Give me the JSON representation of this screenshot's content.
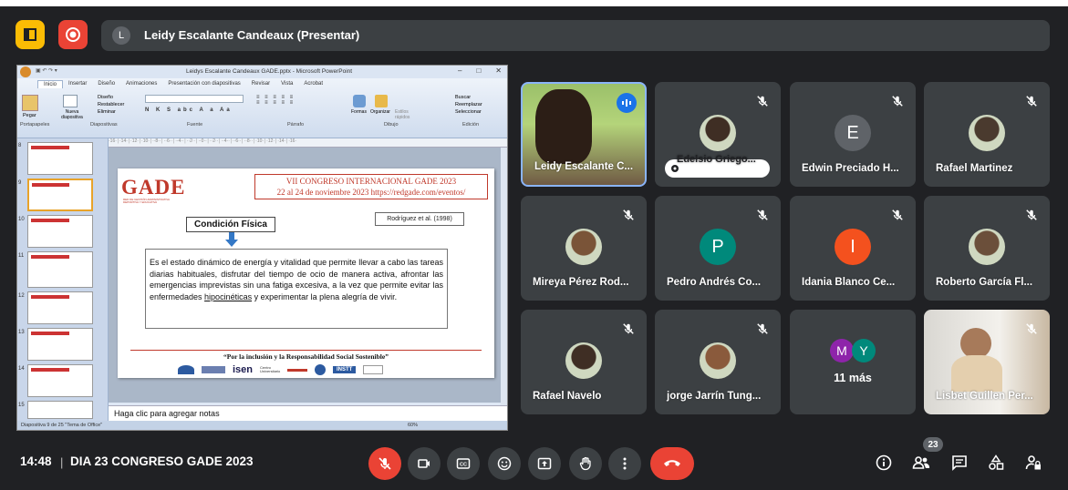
{
  "presenter_bar": {
    "initial": "L",
    "text": "Leidy Escalante Candeaux (Presentar)"
  },
  "ppt": {
    "window_title": "Leidys Escalante Candeaux GADE.pptx - Microsoft PowerPoint",
    "tabs": [
      "Inicio",
      "Insertar",
      "Diseño",
      "Animaciones",
      "Presentación con diapositivas",
      "Revisar",
      "Vista",
      "Acrobat"
    ],
    "groups": [
      "Portapapeles",
      "Diapositivas",
      "Fuente",
      "Párrafo",
      "Dibujo",
      "Edición"
    ],
    "ribbon": {
      "paste": "Pegar",
      "new_slide": "Nueva diapositiva",
      "layout": "Diseño",
      "reset": "Restablecer",
      "delete": "Eliminar",
      "shapes": "Formas",
      "arrange": "Organizar",
      "quick_styles": "Estilos rápidos",
      "find": "Buscar",
      "replace": "Reemplazar",
      "select": "Seleccionar"
    },
    "thumb_numbers": [
      "8",
      "9",
      "10",
      "11",
      "12",
      "13",
      "14",
      "15"
    ],
    "slide": {
      "logo": "GADE",
      "logo_sub": "RED DE GESTIÓN ADMINISTRATIVA DEPORTIVA Y EDUCATIVA",
      "congress_line1": "VII CONGRESO INTERNACIONAL GADE 2023",
      "congress_line2": "22 al 24 de noviembre 2023 https://redgade.com/eventos/",
      "reference": "Rodríguez et al. (1998)",
      "heading": "Condición Física",
      "body_pre": "Es el estado dinámico de energía y vitalidad que permite llevar a cabo las tareas diarias habituales, disfrutar del tiempo de ocio de manera activa, afrontar las emergencias imprevistas sin una fatiga excesiva, a la vez que permite evitar las enfermedades ",
      "body_link": "hipocinéticas",
      "body_post": " y experimentar la plena alegría de vivir.",
      "footer": "“Por la inclusión y la Responsabilidad Social Sostenible”",
      "sponsor1": "isen",
      "sponsor1_sub": "Centro Universitario",
      "sponsor2": "INSTT"
    },
    "notes": "Haga clic para agregar notas",
    "status": "Diapositiva 9 de 25    \"Tema de Office\"",
    "zoom": "60%"
  },
  "participants": [
    {
      "name": "Leidy Escalante C...",
      "speaking": true
    },
    {
      "name": "Edelsio Griego...",
      "muted": true,
      "pill": true
    },
    {
      "name": "Edwin Preciado H...",
      "initial": "E",
      "color": "#5f6368",
      "muted": true
    },
    {
      "name": "Rafael Martinez",
      "muted": true
    },
    {
      "name": "Mireya Pérez Rod...",
      "muted": true
    },
    {
      "name": "Pedro Andrés Co...",
      "initial": "P",
      "color": "#00897b",
      "muted": true
    },
    {
      "name": "Idania Blanco Ce...",
      "initial": "I",
      "color": "#f4511e",
      "muted": true
    },
    {
      "name": "Roberto García Fl...",
      "muted": true
    },
    {
      "name": "Rafael Navelo",
      "muted": true
    },
    {
      "name": "jorge Jarrín Tung...",
      "muted": true
    },
    {
      "name": "Lisbet Guillen Per...",
      "muted": true
    }
  ],
  "more": {
    "initials": [
      "M",
      "Y"
    ],
    "colors": [
      "#8e24aa",
      "#00897b"
    ],
    "text": "11 más"
  },
  "bottom": {
    "time": "14:48",
    "meeting": "DIA 23 CONGRESO GADE 2023",
    "people_count": "23"
  }
}
